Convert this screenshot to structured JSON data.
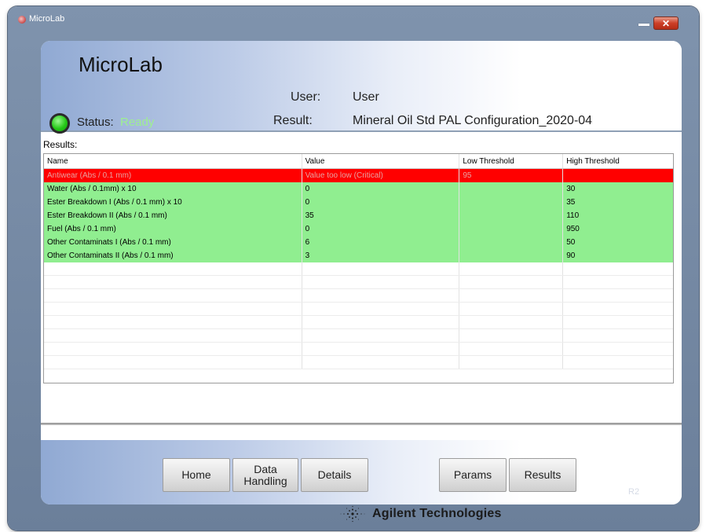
{
  "window": {
    "title": "MicroLab",
    "close_glyph": "✕"
  },
  "header": {
    "app_title": "MicroLab",
    "user_label": "User:",
    "user_value": "User",
    "status_label": "Status:",
    "status_value": "Ready",
    "result_label": "Result:",
    "result_value": "Mineral Oil Std PAL Configuration_2020-04"
  },
  "results": {
    "heading": "Results:",
    "columns": [
      "Name",
      "Value",
      "Low Threshold",
      "High Threshold"
    ],
    "rows": [
      {
        "name": "Antiwear (Abs / 0.1 mm)",
        "value": "Value too low (Critical)",
        "low": "95",
        "high": "",
        "status": "critical"
      },
      {
        "name": "Water (Abs / 0.1mm) x 10",
        "value": "0",
        "low": "",
        "high": "30",
        "status": "ok"
      },
      {
        "name": "Ester Breakdown I (Abs / 0.1 mm) x 10",
        "value": "0",
        "low": "",
        "high": "35",
        "status": "ok"
      },
      {
        "name": "Ester Breakdown II (Abs / 0.1 mm)",
        "value": "35",
        "low": "",
        "high": "110",
        "status": "ok"
      },
      {
        "name": "Fuel (Abs / 0.1 mm)",
        "value": "0",
        "low": "",
        "high": "950",
        "status": "ok"
      },
      {
        "name": "Other Contaminats I (Abs / 0.1 mm)",
        "value": "6",
        "low": "",
        "high": "50",
        "status": "ok"
      },
      {
        "name": "Other Contaminats II (Abs / 0.1 mm)",
        "value": "3",
        "low": "",
        "high": "90",
        "status": "ok"
      }
    ]
  },
  "nav": {
    "home": "Home",
    "data_handling_line1": "Data",
    "data_handling_line2": "Handling",
    "details": "Details",
    "params": "Params",
    "results": "Results",
    "version": "R2"
  },
  "footer": {
    "brand": "Agilent Technologies"
  },
  "colors": {
    "critical_row": "#ff0000",
    "ok_row": "#90ee90",
    "status_ready": "#9ef090"
  },
  "icons": [
    "app-icon",
    "minimize-icon",
    "close-icon",
    "status-led-icon",
    "agilent-spark-logo-icon"
  ]
}
